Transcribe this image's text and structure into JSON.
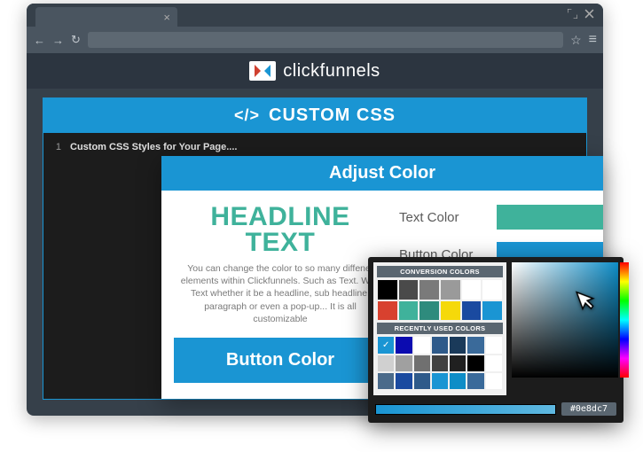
{
  "brand": "clickfunnels",
  "css_panel": {
    "header": "CUSTOM CSS",
    "code_tag": "</>",
    "line_num": "1",
    "line_text": "Custom CSS Styles for Your Page...."
  },
  "modal": {
    "title": "Adjust Color",
    "headline_l1": "HEADLINE",
    "headline_l2": "TEXT",
    "description": "You can change the color to so many diffenet elements within Clickfunnels. Such as Text. With Text whether it be a headline, sub headline, paragraph or even a pop-up... It is all customizable",
    "button_label": "Button Color",
    "opts": [
      {
        "label": "Text Color",
        "color": "#3fb29b"
      },
      {
        "label": "Button Color",
        "color": "#1a95d3"
      }
    ]
  },
  "picker": {
    "title1": "CONVERSION COLORS",
    "title2": "RECENTLY USED COLORS",
    "hex": "#0e8dc7",
    "conversion": [
      "#000000",
      "#4a4a4a",
      "#7a7a7a",
      "#9a9a9a",
      "#ffffff",
      "#ffffff",
      "#d8412f",
      "#3fb29b",
      "#2e8b7d",
      "#f5d90a",
      "#1a4aa0",
      "#1a95d3"
    ],
    "recent": [
      "#1a95d3",
      "#0b0bb0",
      "#ffffff",
      "#2e5a8a",
      "#1a3a5a",
      "#3a6a9a",
      "#ffffff",
      "#d0d0d0",
      "#a0a0a0",
      "#707070",
      "#404040",
      "#202020",
      "#000000",
      "#ffffff",
      "#4a6a8a",
      "#1a4aa0",
      "#2e5a8a",
      "#1a95d3",
      "#0e8dc7",
      "#3a6a9a",
      "#ffffff"
    ],
    "selected_index": 0
  }
}
